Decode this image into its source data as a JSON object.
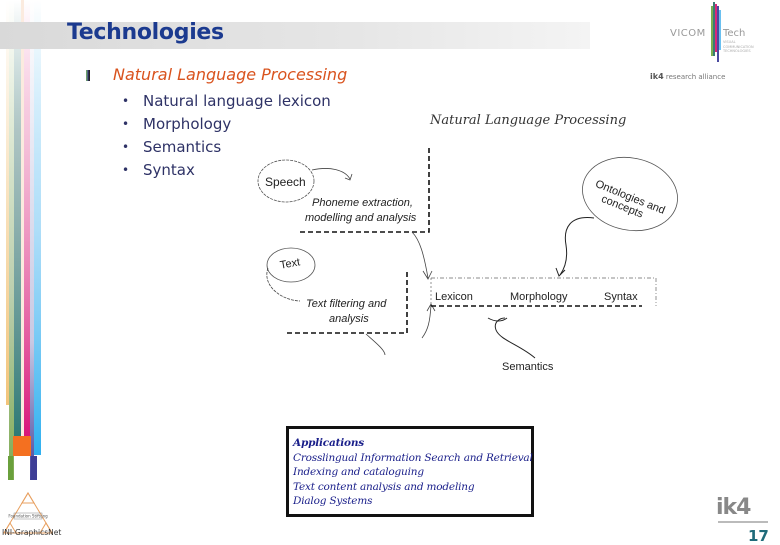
{
  "slide": {
    "title": "Technologies",
    "subheading": "Natural Language Processing",
    "bullets": [
      "Natural language lexicon",
      "Morphology",
      "Semantics",
      "Syntax"
    ],
    "bullet_glyph": "•",
    "page_number": "17"
  },
  "logos": {
    "vicom": "VICOM",
    "tech": "Tech",
    "tech_subtitle": "VISUAL COMMUNICATION TECHNOLOGIES",
    "ik4_brand": "ik4",
    "ik4_tagline": "research alliance",
    "ik4_bottom": "ik4",
    "inigraphics": "INI-GraphicsNet",
    "inigraphics_triangle": "Foundation Stiftung"
  },
  "diagram": {
    "title": "Natural Language Processing",
    "speech": "Speech",
    "phoneme_line1": "Phoneme extraction,",
    "phoneme_line2": "modelling and analysis",
    "text": "Text",
    "text_filter_line1": "Text filtering and",
    "text_filter_line2": "analysis",
    "ontologies_line1": "Ontologies and",
    "ontologies_line2": "concepts",
    "lexicon": "Lexicon",
    "morphology": "Morphology",
    "syntax": "Syntax",
    "semantics": "Semantics"
  },
  "applications": {
    "heading": "Applications",
    "items": [
      "Crosslingual Information Search and Retrieval",
      "Indexing and cataloguing",
      "Text content analysis and modeling",
      "Dialog Systems"
    ]
  },
  "colors": {
    "title": "#1b3a8f",
    "subheading": "#d9531e",
    "bullets": "#2e3266",
    "applications_text": "#1a1f8a",
    "page_number": "#1f6b7a"
  }
}
